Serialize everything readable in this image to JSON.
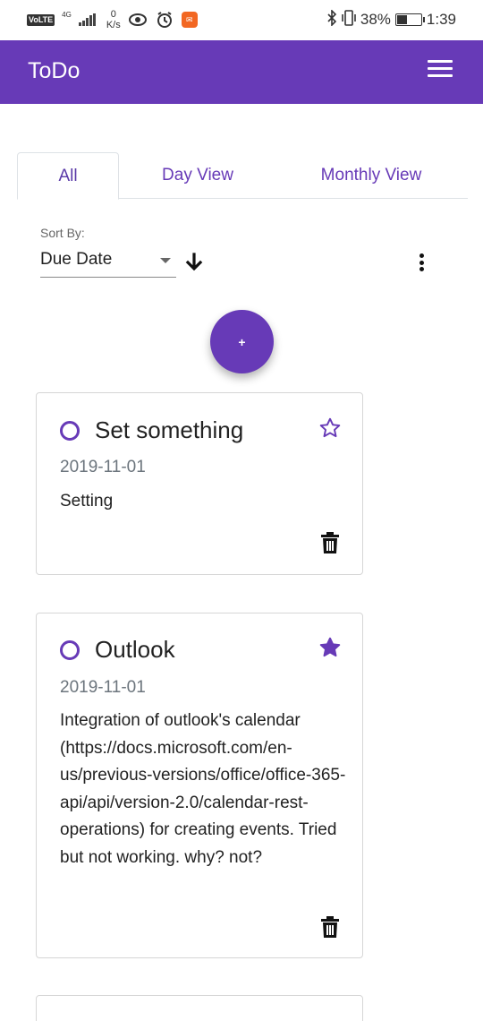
{
  "status_bar": {
    "volte": "VoLTE",
    "network": "4G",
    "speed_value": "0",
    "speed_unit": "K/s",
    "battery": "38%",
    "time": "1:39"
  },
  "app_bar": {
    "title": "ToDo",
    "menu_icon": "hamburger-menu-icon"
  },
  "tabs": [
    {
      "label": "All",
      "active": true
    },
    {
      "label": "Day View",
      "active": false
    },
    {
      "label": "Monthly View",
      "active": false
    }
  ],
  "sort": {
    "label": "Sort By:",
    "value": "Due Date",
    "direction": "descending"
  },
  "fab": {
    "label": "+"
  },
  "todos": [
    {
      "title": "Set something",
      "date": "2019-11-01",
      "description": "Setting",
      "starred": false,
      "completed": false
    },
    {
      "title": "Outlook",
      "date": "2019-11-01",
      "description": "Integration of outlook's calendar (https://docs.microsoft.com/en-us/previous-versions/office/office-365-api/api/version-2.0/calendar-rest-operations) for creating events. Tried but not working. why? not?",
      "starred": true,
      "completed": false
    }
  ],
  "colors": {
    "primary": "#673ab7",
    "date_text": "#6c757d",
    "card_border": "#d6d6d6"
  }
}
